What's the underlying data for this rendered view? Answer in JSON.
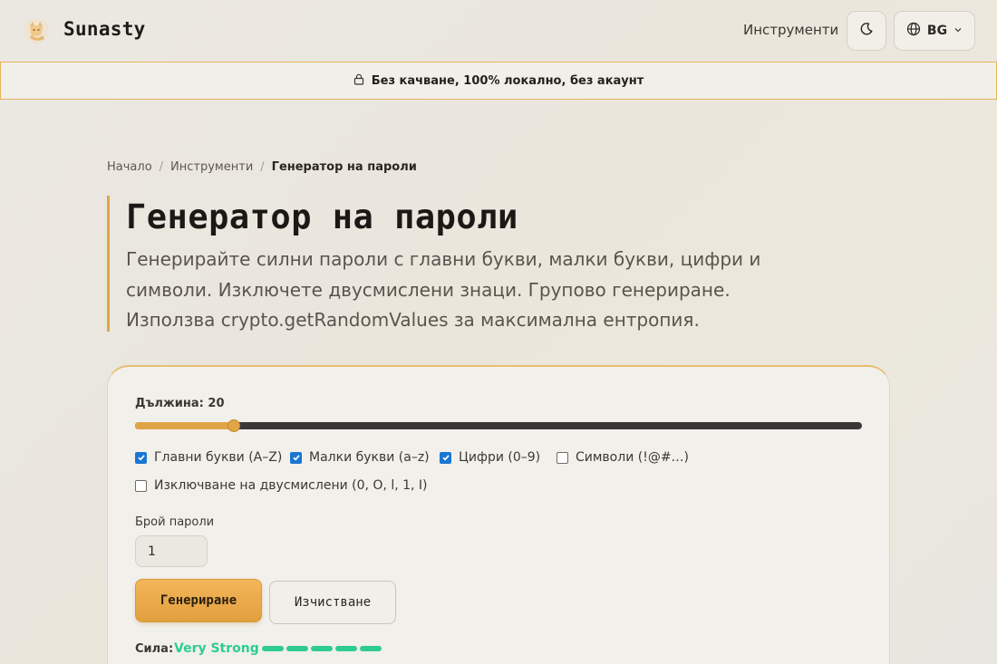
{
  "header": {
    "brand": "Sunasty",
    "nav_tools": "Инструменти",
    "lang": "BG"
  },
  "banner": {
    "text": "Без качване, 100% локално, без акаунт"
  },
  "breadcrumb": {
    "home": "Начало",
    "tools": "Инструменти",
    "current": "Генератор на пароли"
  },
  "hero": {
    "title": "Генератор на пароли",
    "description": "Генерирайте силни пароли с главни букви, малки букви, цифри и символи. Изключете двусмислени знаци. Групово генериране. Използва crypto.getRandomValues за максимална ентропия."
  },
  "card": {
    "length_label": "Дължина: 20",
    "length": {
      "value": 20,
      "min": 4,
      "max": 128
    },
    "options": [
      {
        "label": "Главни букви (A–Z)",
        "checked": true
      },
      {
        "label": "Малки букви (a–z)",
        "checked": true
      },
      {
        "label": "Цифри (0–9)",
        "checked": true
      },
      {
        "label": "Символи (!@#…)",
        "checked": false
      },
      {
        "label": "Изключване на двусмислени (0, O, l, 1, I)",
        "checked": false
      }
    ],
    "count_label": "Брой пароли",
    "count_value": "1",
    "generate_label": "Генериране",
    "clear_label": "Изчистване",
    "strength_label": "Сила:",
    "strength_value": "Very Strong",
    "strength_level": 5
  },
  "colors": {
    "accent": "#e0a546",
    "strength": "#2ecc8e",
    "checkbox": "#1976d2"
  },
  "icons": {
    "logo": "fox-logo-icon",
    "theme": "moon-icon",
    "lang": "globe-icon",
    "banner": "lock-icon"
  }
}
